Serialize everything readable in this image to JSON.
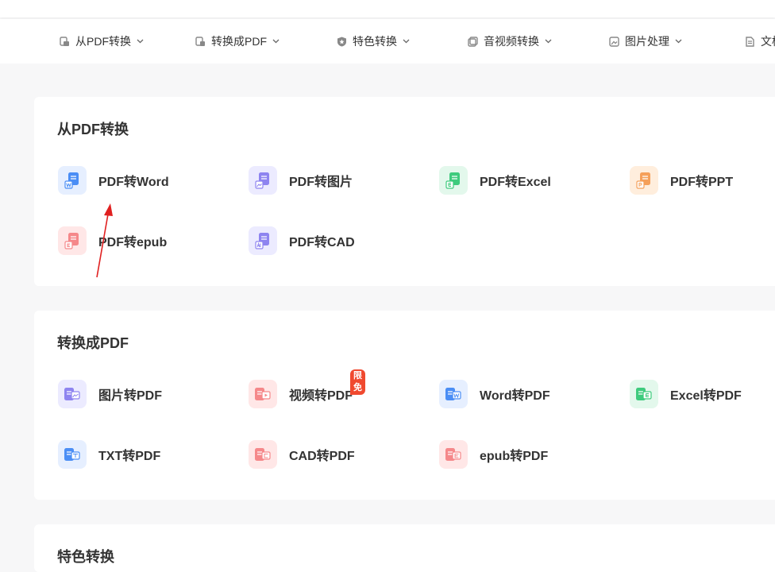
{
  "nav": {
    "items": [
      {
        "label": "从PDF转换",
        "icon": "pdf-doc-icon"
      },
      {
        "label": "转换成PDF",
        "icon": "to-pdf-icon"
      },
      {
        "label": "特色转换",
        "icon": "star-shield-icon"
      },
      {
        "label": "音视频转换",
        "icon": "media-icon"
      },
      {
        "label": "图片处理",
        "icon": "image-icon"
      },
      {
        "label": "文档处理",
        "icon": "document-icon"
      }
    ]
  },
  "sections": [
    {
      "title": "从PDF转换",
      "tools": [
        {
          "label": "PDF转Word",
          "icon": "word-icon",
          "color": "#4b8ef5",
          "bg": "#e6efff"
        },
        {
          "label": "PDF转图片",
          "icon": "image-icon",
          "color": "#8e84f0",
          "bg": "#ecebff"
        },
        {
          "label": "PDF转Excel",
          "icon": "excel-icon",
          "color": "#3ecb7d",
          "bg": "#e3f8ec"
        },
        {
          "label": "PDF转PPT",
          "icon": "ppt-icon",
          "color": "#f5a05a",
          "bg": "#ffeedd"
        },
        {
          "label": "PDF转epub",
          "icon": "epub-icon",
          "color": "#f5888a",
          "bg": "#ffe7e7"
        },
        {
          "label": "PDF转CAD",
          "icon": "cad-icon",
          "color": "#8e84f0",
          "bg": "#ecebff"
        }
      ]
    },
    {
      "title": "转换成PDF",
      "tools": [
        {
          "label": "图片转PDF",
          "icon": "image-icon",
          "color": "#8e84f0",
          "bg": "#ecebff"
        },
        {
          "label": "视频转PDF",
          "icon": "video-icon",
          "color": "#f5888a",
          "bg": "#ffe7e7",
          "badge": "限免"
        },
        {
          "label": "Word转PDF",
          "icon": "word-icon",
          "color": "#4b8ef5",
          "bg": "#e6efff"
        },
        {
          "label": "Excel转PDF",
          "icon": "excel-icon",
          "color": "#3ecb7d",
          "bg": "#e3f8ec"
        },
        {
          "label": "TXT转PDF",
          "icon": "txt-icon",
          "color": "#4b8ef5",
          "bg": "#e6efff"
        },
        {
          "label": "CAD转PDF",
          "icon": "cad-icon",
          "color": "#f5888a",
          "bg": "#ffe7e7"
        },
        {
          "label": "epub转PDF",
          "icon": "epub-icon",
          "color": "#f5888a",
          "bg": "#ffe7e7"
        }
      ]
    },
    {
      "title": "特色转换"
    }
  ],
  "annotation": {
    "color": "#e02020"
  }
}
